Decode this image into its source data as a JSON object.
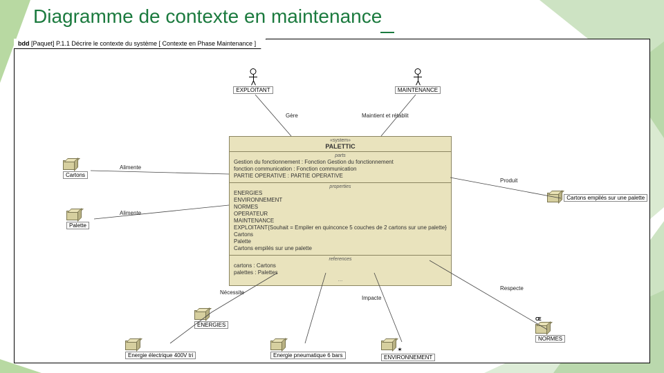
{
  "title": "Diagramme de contexte en maintenance",
  "frame_label_prefix": "bdd",
  "frame_label_pkg": "[Paquet] P.1.1",
  "frame_label_rest": "Décrire le contexte du système [ Contexte en Phase Maintenance ]",
  "actors": {
    "exploitant": "EXPLOITANT",
    "maintenance": "MAINTENANCE"
  },
  "blocks": {
    "cartons": "Cartons",
    "palette": "Palette",
    "energies": "ENERGIES",
    "energie_elec": "Energie électrique 400V tri",
    "energie_pneu": "Energie pneumatique 6 bars",
    "environnement": "ENVIRONNEMENT",
    "normes": "NORMES",
    "normes_badge": "CE",
    "produit": "Cartons empilés sur une palette"
  },
  "edges": {
    "gere": "Gère",
    "maintient": "Maintient et rétablit",
    "alimente1": "Alimente",
    "alimente2": "Alimente",
    "necessite": "Nécessite",
    "impacte": "Impacte",
    "respecte": "Respecte",
    "produit": "Produit"
  },
  "system": {
    "stereotype": "«system»",
    "name": "PALETTIC",
    "parts_title": "parts",
    "parts": [
      "Gestion du fonctionnement : Fonction Gestion du fonctionnement",
      "fonction communication : Fonction communication",
      "PARTIE OPERATIVE : PARTIE OPERATIVE"
    ],
    "props_title": "properties",
    "props": [
      "ENERGIES",
      "ENVIRONNEMENT",
      "NORMES",
      "OPERATEUR",
      "MAINTENANCE",
      "EXPLOITANT{Souhait = Empiler en quinconce 5 couches de 2 cartons sur une palette}",
      "Cartons",
      "Palette",
      "Cartons empilés sur une palette"
    ],
    "refs_title": "references",
    "refs": [
      "cartons : Cartons",
      "palettes : Palettes"
    ],
    "ellipsis": "..."
  }
}
